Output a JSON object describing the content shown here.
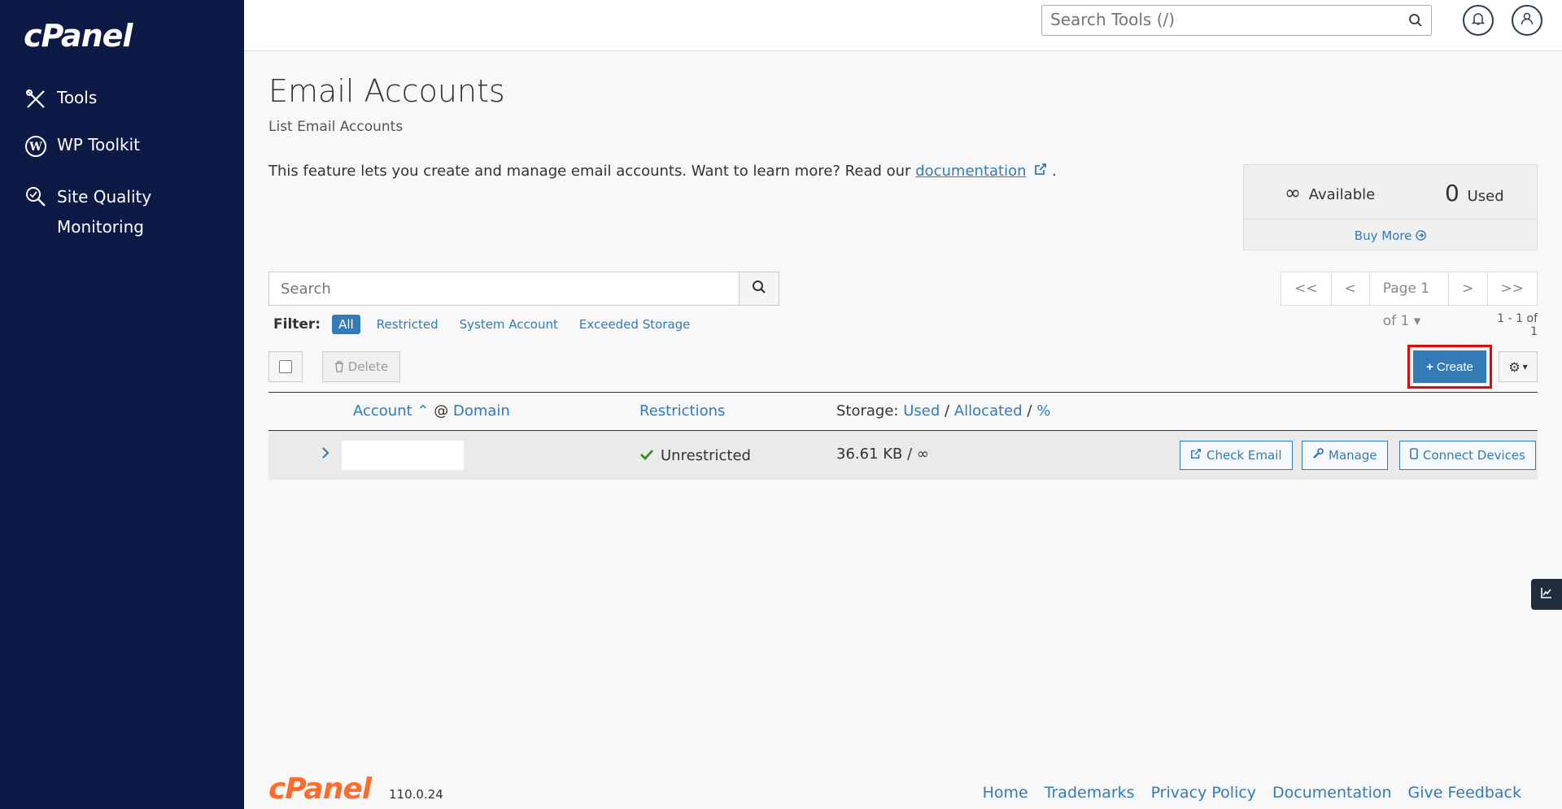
{
  "sidebar": {
    "logo": "cPanel",
    "items": [
      {
        "label": "Tools",
        "icon": "tools-icon"
      },
      {
        "label": "WP Toolkit",
        "icon": "wordpress-icon"
      },
      {
        "label": "Site Quality Monitoring",
        "icon": "site-quality-icon"
      }
    ]
  },
  "header": {
    "search_placeholder": "Search Tools (/)"
  },
  "page": {
    "title": "Email Accounts",
    "subtitle": "List Email Accounts",
    "description": "This feature lets you create and manage email accounts. Want to learn more? Read our",
    "doc_link": "documentation",
    "desc_end": "."
  },
  "stats": {
    "available_symbol": "∞",
    "available_label": "Available",
    "used_count": "0",
    "used_label": "Used",
    "buy_more": "Buy More"
  },
  "search": {
    "placeholder": "Search"
  },
  "pager": {
    "first": "<<",
    "prev": "<",
    "page": "Page 1 of 1",
    "next": ">",
    "last": ">>",
    "count": "1 - 1 of 1"
  },
  "filter": {
    "label": "Filter:",
    "options": [
      "All",
      "Restricted",
      "System Account",
      "Exceeded Storage"
    ]
  },
  "toolbar": {
    "delete": "Delete",
    "create": "Create"
  },
  "table": {
    "col_account": "Account",
    "col_at": "@",
    "col_domain": "Domain",
    "col_restrictions": "Restrictions",
    "col_storage": "Storage:",
    "col_used": "Used",
    "col_allocated": "Allocated",
    "col_percent": "%",
    "sep": "/",
    "rows": [
      {
        "restriction": "Unrestricted",
        "storage": "36.61 KB / ∞",
        "check_email": "Check Email",
        "manage": "Manage",
        "connect": "Connect Devices"
      }
    ]
  },
  "footer": {
    "logo": "cPanel",
    "version": "110.0.24",
    "links": [
      "Home",
      "Trademarks",
      "Privacy Policy",
      "Documentation",
      "Give Feedback"
    ]
  },
  "colors": {
    "sidebar": "#0c1a45",
    "accent": "#337ab7",
    "footer_logo": "#ff6c2c",
    "highlight": "#ee0000"
  }
}
